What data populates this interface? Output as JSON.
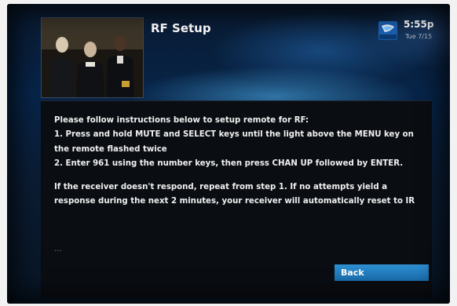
{
  "header": {
    "title": "RF Setup",
    "time": "5:55p",
    "date": "Tue 7/15",
    "logo_icon": "directv-logo-icon"
  },
  "preview": {
    "icon": "live-tv-preview"
  },
  "message": {
    "lines": [
      "Please follow instructions below to setup remote for RF:",
      "1. Press and hold MUTE and SELECT keys until the light above the MENU key on",
      "the remote flashed twice",
      "2. Enter 961 using the number keys, then press CHAN UP followed by ENTER.",
      "If the receiver doesn't respond, repeat from step 1. If no attempts yield a",
      "response during the next 2 minutes, your receiver will automatically reset to IR"
    ],
    "ellipsis": "..."
  },
  "actions": {
    "back_label": "Back"
  },
  "colors": {
    "accent": "#2f8fd0",
    "panel": "#0a0d12",
    "text": "#f0f0f0"
  }
}
